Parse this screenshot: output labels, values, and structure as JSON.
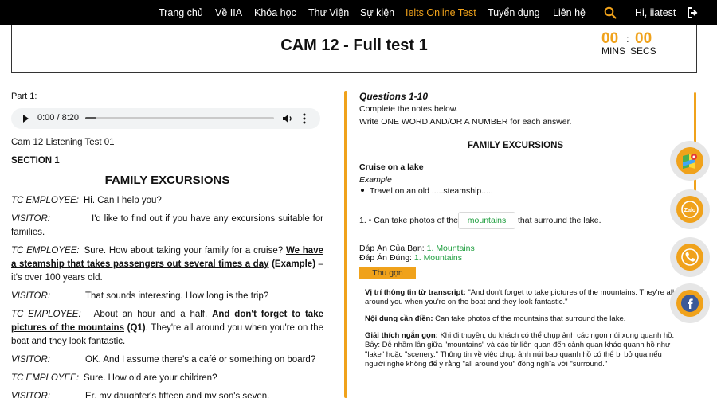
{
  "nav": {
    "items": [
      {
        "label": "Trang chủ",
        "active": false
      },
      {
        "label": "Về IIA",
        "active": false
      },
      {
        "label": "Khóa học",
        "active": false
      },
      {
        "label": "Thư Viện",
        "active": false
      },
      {
        "label": "Sự kiện",
        "active": false
      },
      {
        "label": "Ielts Online Test",
        "active": true
      },
      {
        "label": "Tuyển dụng",
        "active": false
      },
      {
        "label": "Liên hệ",
        "active": false
      }
    ],
    "search_icon": "search-icon",
    "user_greeting": "Hi, iiatest",
    "logout_icon": "logout-icon"
  },
  "header": {
    "title": "CAM 12 - Full test 1",
    "timer": {
      "mins": "00",
      "secs": "00",
      "separator": ":",
      "mins_label": "MINS",
      "secs_label": "SECS"
    }
  },
  "left": {
    "part_label": "Part 1:",
    "audio": {
      "time": "0:00 / 8:20",
      "progress": 0
    },
    "test_name": "Cam 12 Listening Test 01",
    "section": "SECTION 1",
    "heading": "FAMILY EXCURSIONS",
    "transcript": [
      {
        "speaker": "TC EMPLOYEE:",
        "text": "Hi. Can I help you?"
      },
      {
        "speaker": "VISITOR:",
        "text": "I'd like to find out if you have any excursions suitable for families."
      },
      {
        "speaker": "TC EMPLOYEE:",
        "text": "Sure. How about taking your family for a cruise?",
        "bold_u": "We have a steamship that takes passengers out several times a day",
        "tag": "(Example)",
        "text_after": "– it's over 100 years old."
      },
      {
        "speaker": "VISITOR:",
        "text": "That sounds interesting. How long is the trip?"
      },
      {
        "speaker": "TC EMPLOYEE:",
        "text": "About an hour and a half.",
        "bold_u": "And don't forget to take pictures of the mountains",
        "tag": "(Q1)",
        "text_after": ". They're all around you when you're on the boat and they look fantastic."
      },
      {
        "speaker": "VISITOR:",
        "text": "OK. And I assume there's a café or something on board?"
      },
      {
        "speaker": "TC EMPLOYEE:",
        "text": "Sure. How old are your children?"
      },
      {
        "speaker": "VISITOR:",
        "text": "Er, my daughter's fifteen and my son's seven."
      }
    ]
  },
  "right": {
    "questions_title": "Questions 1-10",
    "instruction_1": "Complete the notes below.",
    "instruction_2": "Write ONE WORD AND/OR A NUMBER for each answer.",
    "heading": "FAMILY EXCURSIONS",
    "subheading": "Cruise on a lake",
    "example_label": "Example",
    "example_item": "Travel on an old .....steamship.....",
    "q1": {
      "prefix": "1. • Can take photos of the",
      "value": "mountains",
      "suffix": "that surround the lake."
    },
    "your_answer_label": "Đáp Án Của Bạn:",
    "your_answer": "1. Mountains",
    "correct_answer_label": "Đáp Án Đúng:",
    "correct_answer": "1. Mountains",
    "collapse_label": "Thu gọn",
    "explain": {
      "location_label": "Vị trí thông tin từ transcript:",
      "location_text": "\"And don't forget to take pictures of the mountains. They're all around you when you're on the boat and they look fantastic.\"",
      "fill_label": "Nội dung cần điền:",
      "fill_text": "Can take photos of the mountains that surround the lake.",
      "short_label": "Giải thích ngắn gọn:",
      "short_text": "Khi đi thuyền, du khách có thể chụp ảnh các ngọn núi xung quanh hồ. Bẫy: Dễ nhầm lẫn giữa \"mountains\" và các từ liên quan đến cảnh quan khác quanh hồ như \"lake\" hoặc \"scenery.\" Thông tin về việc chụp ảnh núi bao quanh hồ có thể bị bỏ qua nếu người nghe không để ý rằng \"all around you\" đồng nghĩa với \"surround.\""
    }
  },
  "floating": [
    {
      "icon": "maps-icon",
      "label": ""
    },
    {
      "icon": "zalo-icon",
      "label": "Zalo"
    },
    {
      "icon": "phone-icon",
      "label": ""
    },
    {
      "icon": "facebook-icon",
      "label": ""
    }
  ],
  "colors": {
    "accent": "#f0a21b",
    "answer_green": "#1e9e3e",
    "nav_bg": "#000000"
  }
}
